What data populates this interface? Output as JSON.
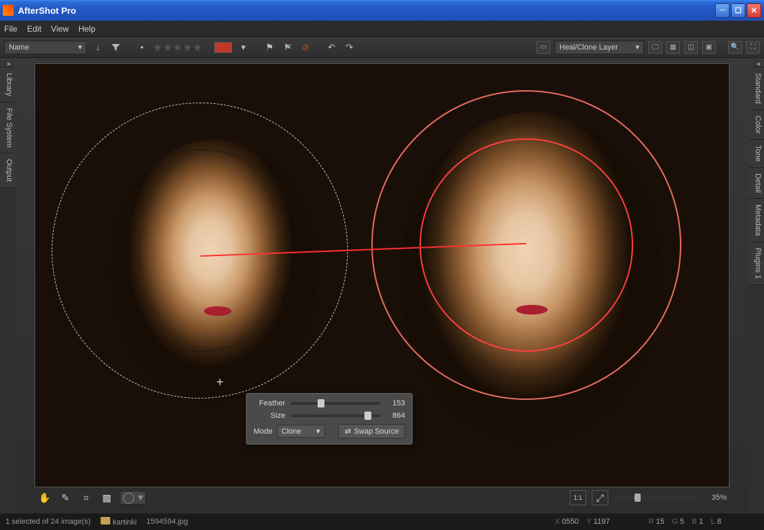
{
  "titlebar": {
    "title": "AfterShot Pro"
  },
  "menubar": {
    "items": [
      "File",
      "Edit",
      "View",
      "Help"
    ]
  },
  "toolbar": {
    "sort_by": "Name",
    "color_label": "#c03828",
    "layer_select": "Heal/Clone Layer"
  },
  "left_tabs": [
    "Library",
    "File System",
    "Output"
  ],
  "right_tabs": [
    "Standard",
    "Color",
    "Tone",
    "Detail",
    "Metadata",
    "Plugins 1"
  ],
  "clone_panel": {
    "feather_label": "Feather",
    "feather_value": "153",
    "size_label": "Size",
    "size_value": "864",
    "mode_label": "Mode",
    "mode_value": "Clone",
    "swap_label": "Swap Source"
  },
  "zoom": {
    "percent": "35%"
  },
  "statusbar": {
    "selection": "1 selected of 24 image(s)",
    "folder": "kartinki",
    "filename": "1594594.jpg",
    "coords_label_x": "X",
    "coords_x": "0550",
    "coords_label_y": "Y",
    "coords_y": "1197",
    "r_label": "R",
    "r_val": "15",
    "g_label": "G",
    "g_val": "5",
    "b_label": "B",
    "b_val": "1",
    "l_label": "L",
    "l_val": "8"
  }
}
